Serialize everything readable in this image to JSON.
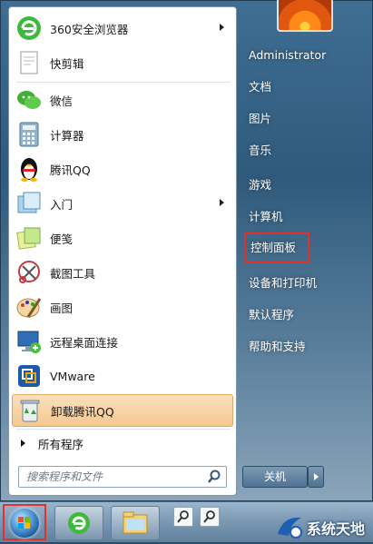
{
  "left_menu": {
    "pinned": [
      {
        "label": "360安全浏览器",
        "icon": "360-browser-icon",
        "has_submenu": true
      },
      {
        "label": "快剪辑",
        "icon": "video-editor-icon",
        "has_submenu": false
      }
    ],
    "recent": [
      {
        "label": "微信",
        "icon": "wechat-icon",
        "has_submenu": false
      },
      {
        "label": "计算器",
        "icon": "calculator-icon",
        "has_submenu": false
      },
      {
        "label": "腾讯QQ",
        "icon": "qq-penguin-icon",
        "has_submenu": false
      },
      {
        "label": "入门",
        "icon": "getting-started-icon",
        "has_submenu": true
      },
      {
        "label": "便笺",
        "icon": "sticky-notes-icon",
        "has_submenu": false
      },
      {
        "label": "截图工具",
        "icon": "snipping-tool-icon",
        "has_submenu": false
      },
      {
        "label": "画图",
        "icon": "paint-icon",
        "has_submenu": false
      },
      {
        "label": "远程桌面连接",
        "icon": "remote-desktop-icon",
        "has_submenu": false
      },
      {
        "label": "VMware",
        "icon": "vmware-icon",
        "has_submenu": false
      },
      {
        "label": "卸载腾讯QQ",
        "icon": "recycle-bin-icon",
        "has_submenu": false,
        "highlighted": true
      }
    ],
    "all_programs": "所有程序",
    "search_placeholder": "搜索程序和文件"
  },
  "right_menu": {
    "user": "Administrator",
    "items": [
      "文档",
      "图片",
      "音乐",
      "游戏",
      "计算机",
      "控制面板",
      "设备和打印机",
      "默认程序",
      "帮助和支持"
    ],
    "boxed_item": "控制面板",
    "shutdown_label": "关机"
  },
  "watermark": {
    "text": "系统天地"
  },
  "colors": {
    "highlight_box": "#e13030",
    "hover_orange": "#f5c892"
  }
}
